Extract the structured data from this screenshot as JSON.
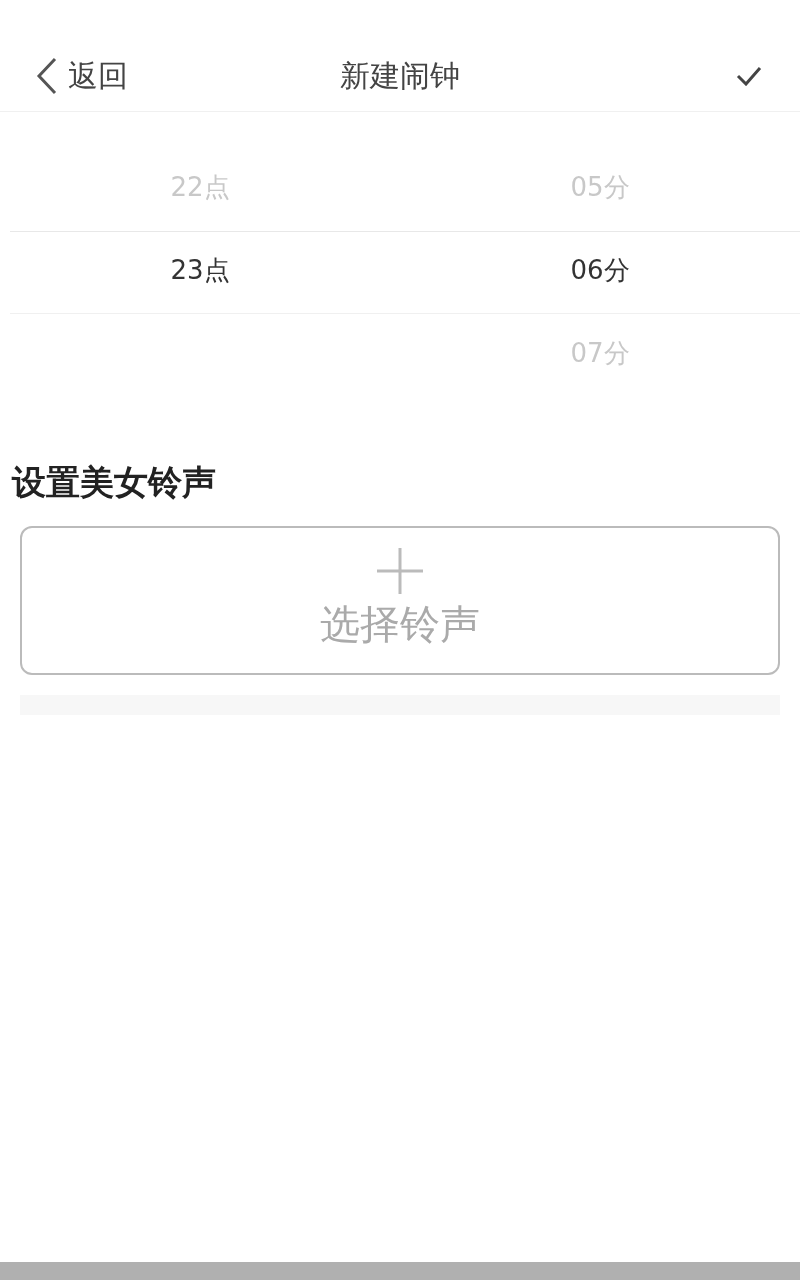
{
  "header": {
    "back_label": "返回",
    "title": "新建闹钟"
  },
  "picker": {
    "hours": [
      {
        "label": "22点",
        "selected": false
      },
      {
        "label": "23点",
        "selected": true
      }
    ],
    "minutes": [
      {
        "label": "05分",
        "selected": false
      },
      {
        "label": "06分",
        "selected": true
      },
      {
        "label": "07分",
        "selected": false
      }
    ]
  },
  "ringtone": {
    "heading": "设置美女铃声",
    "button_label": "选择铃声"
  }
}
